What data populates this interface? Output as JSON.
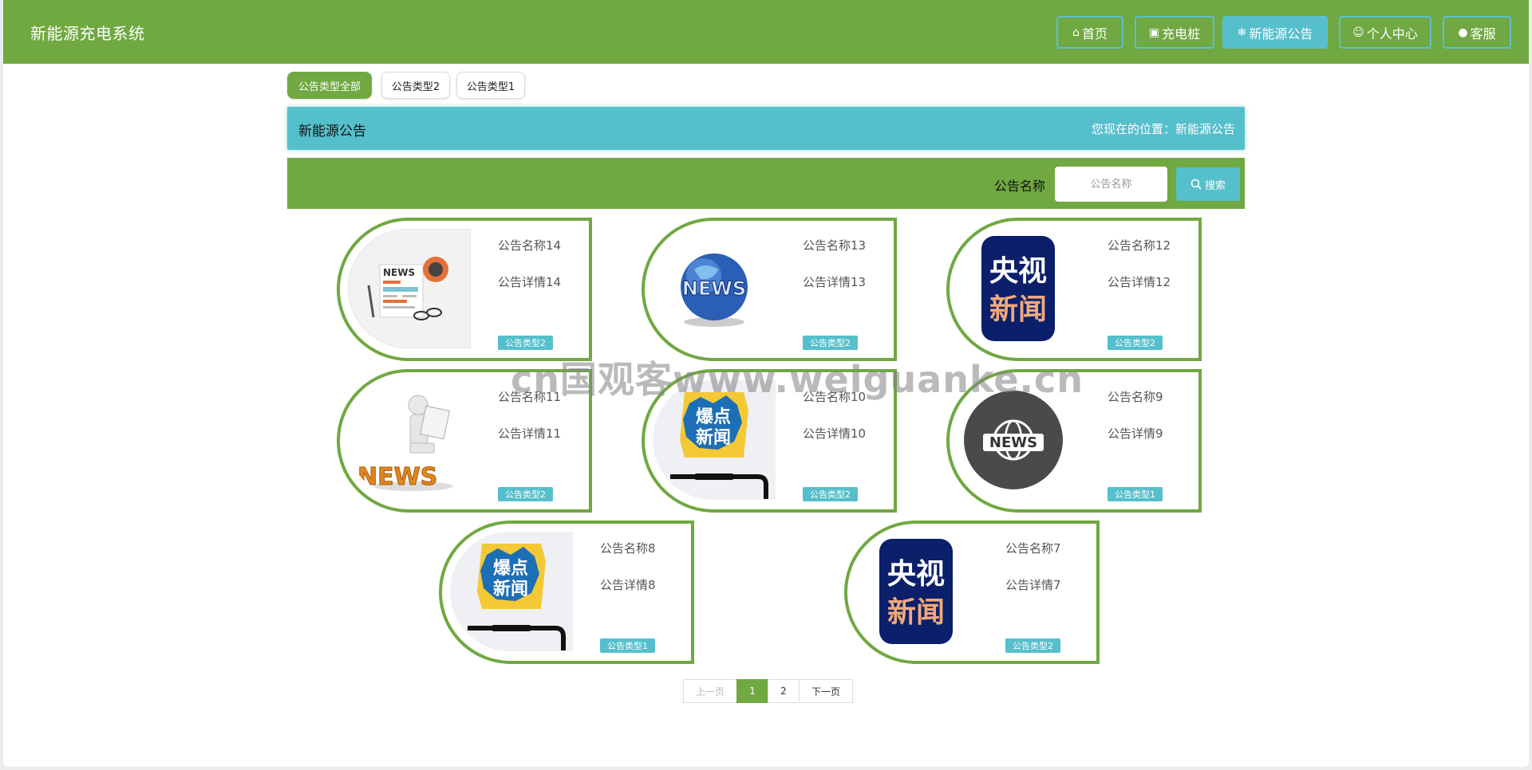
{
  "header": {
    "brand": "新能源充电系统",
    "nav": [
      {
        "icon": "home-icon",
        "glyph": "⌂",
        "label": "首页",
        "active": false
      },
      {
        "icon": "charger-icon",
        "glyph": "▣",
        "label": "充电桩",
        "active": false
      },
      {
        "icon": "snowflake-icon",
        "glyph": "❄",
        "label": "新能源公告",
        "active": true
      },
      {
        "icon": "user-icon",
        "glyph": "☺",
        "label": "个人中心",
        "active": false
      },
      {
        "icon": "wechat-icon",
        "glyph": "●",
        "label": "客服",
        "active": false
      }
    ]
  },
  "types": [
    {
      "label": "公告类型全部",
      "active": true
    },
    {
      "label": "公告类型2",
      "active": false
    },
    {
      "label": "公告类型1",
      "active": false
    }
  ],
  "title_bar": {
    "title": "新能源公告",
    "location": "您现在的位置：新能源公告"
  },
  "search": {
    "label": "公告名称",
    "placeholder": "公告名称",
    "button_label": "搜索"
  },
  "cards": [
    {
      "name": "公告名称14",
      "detail": "公告详情14",
      "type": "公告类型2",
      "image": "newspaper-news-image"
    },
    {
      "name": "公告名称13",
      "detail": "公告详情13",
      "type": "公告类型2",
      "image": "globe-news-image"
    },
    {
      "name": "公告名称12",
      "detail": "公告详情12",
      "type": "公告类型2",
      "image": "cctv-news-image"
    },
    {
      "name": "公告名称11",
      "detail": "公告详情11",
      "type": "公告类型2",
      "image": "figure-news-image"
    },
    {
      "name": "公告名称10",
      "detail": "公告详情10",
      "type": "公告类型2",
      "image": "breaking-news-phone-image"
    },
    {
      "name": "公告名称9",
      "detail": "公告详情9",
      "type": "公告类型1",
      "image": "world-news-badge-image"
    },
    {
      "name": "公告名称8",
      "detail": "公告详情8",
      "type": "公告类型1",
      "image": "breaking-news-phone-image"
    },
    {
      "name": "公告名称7",
      "detail": "公告详情7",
      "type": "公告类型2",
      "image": "cctv-news-image"
    }
  ],
  "image_text": {
    "news": "NEWS",
    "cctv_line1": "央视",
    "cctv_line2": "新闻",
    "breaking_line1": "爆点",
    "breaking_line2": "新闻"
  },
  "pagination": {
    "prev": "上一页",
    "pages": [
      "1",
      "2"
    ],
    "current": "1",
    "next": "下一页"
  },
  "watermark": "cn国观客www.weiguanke.cn",
  "colors": {
    "primary_green": "#70a841",
    "accent_teal": "#56bfcc"
  }
}
